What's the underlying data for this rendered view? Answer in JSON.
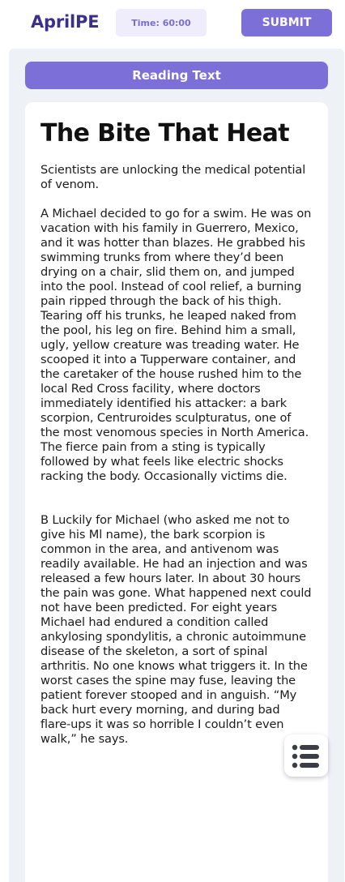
{
  "header": {
    "brand": "AprilPE",
    "timer": "Time: 60:00",
    "submit_label": "SUBMIT"
  },
  "section_tab": "Reading Text",
  "article": {
    "title": "The Bite That Heat",
    "subtitle": "Scientists are unlocking the medical potential of venom.",
    "paragraphs": [
      "A Michael decided to go for a swim. He was on vacation with his family in Guerrero, Mexico, and it was hotter than blazes. He grabbed his swimming trunks from where they’d been drying on a chair, slid them on, and jumped into the pool. Instead of cool relief, a burning pain ripped through the back of his thigh. Tearing off his trunks, he leaped naked from the pool, his leg on fire. Behind him a small, ugly, yellow creature was treading water. He scooped it into a Tupperware container, and the caretaker of the house rushed him to the local Red Cross facility, where doctors immediately identified his attacker: a bark scorpion, Centruroides sculpturatus, one of the most venomous species in North America. The fierce pain from a sting is typically followed by what feels like electric shocks racking the body. Occasionally victims die.",
      "B Luckily for Michael (who asked me not to give his Ml name), the bark scorpion is common in the area, and antivenom was readily available. He had an injection and was released a few hours later. In about 30 hours the pain was gone. What happened next could not have been predicted. For eight years Michael had endured a condition called ankylosing spondylitis, a chronic autoimmune disease of the skeleton, a sort of spinal arthritis. No one knows what triggers it. In the worst cases the spine may fuse, leaving the patient forever stooped and in anguish. “My back hurt every morning, and during bad flare-ups it was so horrible I couldn’t even walk,” he says."
    ]
  },
  "floating_button_icon": "list-icon",
  "colors": {
    "accent": "#7c6fd8",
    "brand": "#3b2f8a",
    "panel_bg": "#eef1f6",
    "timer_bg": "#efedfb"
  }
}
